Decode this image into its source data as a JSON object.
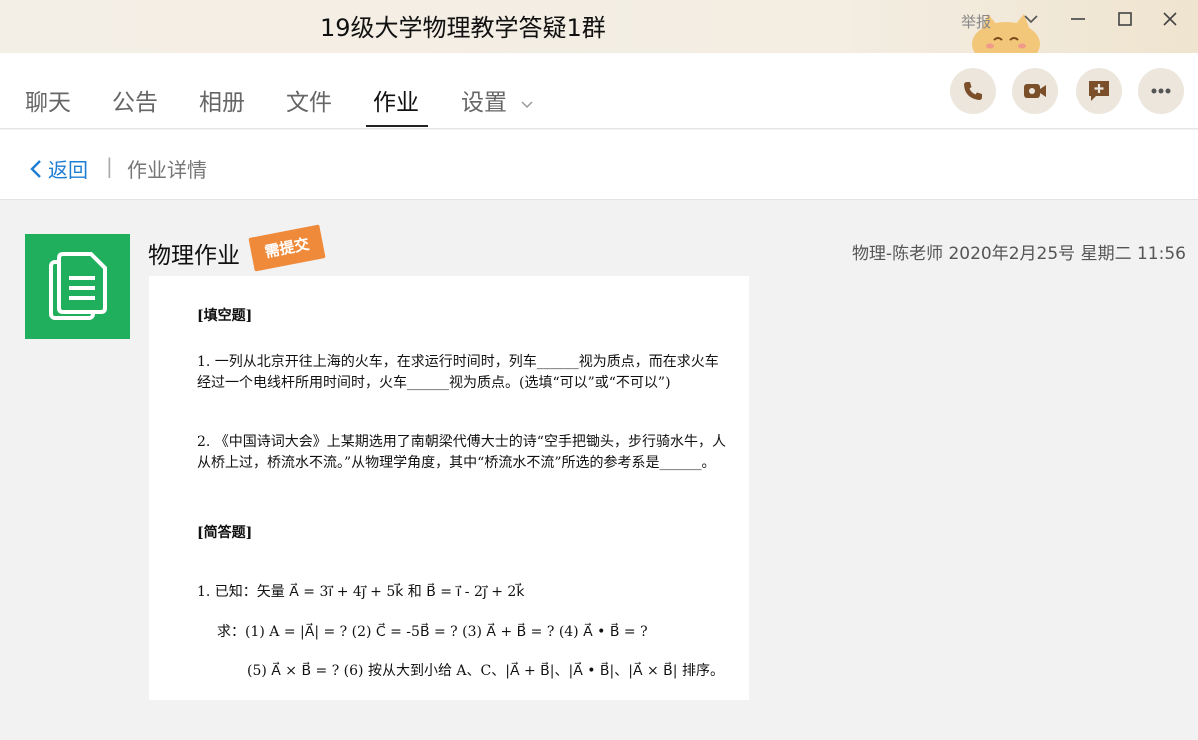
{
  "window": {
    "title": "19级大学物理教学答疑1群",
    "report_label": "举报",
    "minimize": "—",
    "maximize": "☐",
    "close": "✕"
  },
  "tabs": [
    {
      "label": "聊天"
    },
    {
      "label": "公告"
    },
    {
      "label": "相册"
    },
    {
      "label": "文件"
    },
    {
      "label": "作业",
      "active": true
    },
    {
      "label": "设置"
    }
  ],
  "breadcrumb": {
    "back_label": "返回",
    "separator": "|",
    "title": "作业详情"
  },
  "homework": {
    "title": "物理作业",
    "stamp": "需提交",
    "meta": "物理-陈老师 2020年2月25号 星期二 11:56"
  },
  "sheet": {
    "fill_heading": "[填空题]",
    "q1": "1. 一列从北京开往上海的火车，在求运行时间时，列车______视为质点，而在求火车经过一个电线杆所用时间时，火车______视为质点。(选填“可以”或“不可以”)",
    "q2": "2. 《中国诗词大会》上某期选用了南朝梁代傅大士的诗“空手把锄头，步行骑水牛，人从桥上过，桥流水不流。”从物理学角度，其中“桥流水不流”所选的参考系是______。",
    "short_heading": "[简答题]",
    "s1": "1. 已知：矢量 A⃗ = 3i⃗ + 4j⃗ + 5k⃗    和   B⃗ = i⃗ - 2j⃗ + 2k⃗",
    "s2": "求：(1) A = |A⃗| = ?    (2) C⃗ = -5B⃗ = ?    (3) A⃗ + B⃗ = ?    (4) A⃗ • B⃗ = ?",
    "s3": "(5) A⃗ × B⃗ = ?     (6) 按从大到小给 A、C、|A⃗ + B⃗|、|A⃗ • B⃗|、|A⃗ × B⃗| 排序。"
  },
  "colors": {
    "accent": "#1e7ed4",
    "icon_green": "#20b05d",
    "stamp_orange": "#f08a3b"
  }
}
